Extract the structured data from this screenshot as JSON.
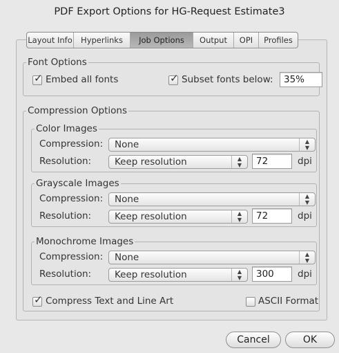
{
  "window": {
    "title": "PDF Export Options for HG-Request Estimate3"
  },
  "tabs": [
    {
      "label": "Layout Info"
    },
    {
      "label": "Hyperlinks"
    },
    {
      "label": "Job Options"
    },
    {
      "label": "Output"
    },
    {
      "label": "OPI"
    },
    {
      "label": "Profiles"
    }
  ],
  "font_options": {
    "legend": "Font Options",
    "embed_all_label": "Embed all fonts",
    "embed_all_checked": true,
    "subset_label": "Subset fonts below:",
    "subset_checked": true,
    "subset_value": "35%"
  },
  "compression": {
    "legend": "Compression Options",
    "compression_label": "Compression:",
    "resolution_label": "Resolution:",
    "unit": "dpi",
    "color": {
      "legend": "Color Images",
      "compression_value": "None",
      "resolution_value": "Keep resolution",
      "dpi": "72"
    },
    "grayscale": {
      "legend": "Grayscale Images",
      "compression_value": "None",
      "resolution_value": "Keep resolution",
      "dpi": "72"
    },
    "monochrome": {
      "legend": "Monochrome Images",
      "compression_value": "None",
      "resolution_value": "Keep resolution",
      "dpi": "300"
    },
    "compress_text_label": "Compress Text and Line Art",
    "compress_text_checked": true,
    "ascii_label": "ASCII Format",
    "ascii_checked": false
  },
  "buttons": {
    "cancel": "Cancel",
    "ok": "OK"
  },
  "glyphs": {
    "check": "✓",
    "stepper_up": "▲",
    "stepper_down": "▼"
  }
}
